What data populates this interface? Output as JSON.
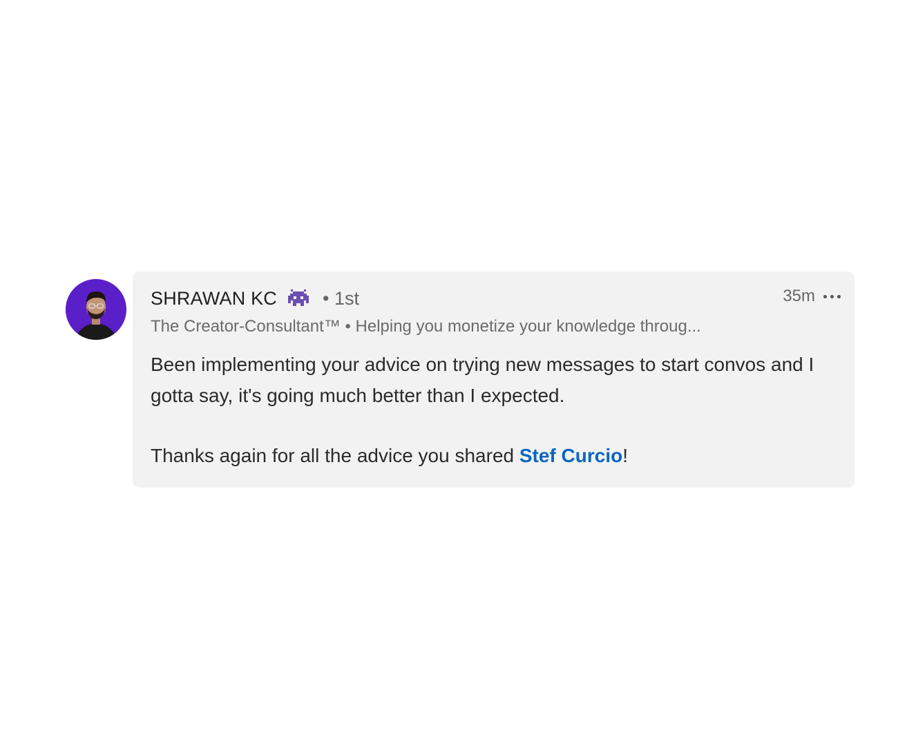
{
  "comment": {
    "author": {
      "name": "SHRAWAN KC",
      "connection_degree": "• 1st",
      "headline": "The Creator-Consultant™ • Helping you monetize your knowledge throug...",
      "badge_icon": "space-invader-icon",
      "avatar_bg": "#5b1fc9"
    },
    "timestamp": "35m",
    "more_icon": "more-dots-icon",
    "paragraph1": "Been implementing your advice on trying new messages to start convos and I gotta say, it's going much better than I expected.",
    "paragraph2_prefix": "Thanks again for all the advice you shared ",
    "mention": "Stef Curcio",
    "paragraph2_suffix": "!",
    "colors": {
      "bubble_bg": "#f2f2f2",
      "mention": "#0a66c2",
      "badge": "#6b4fb0"
    }
  }
}
